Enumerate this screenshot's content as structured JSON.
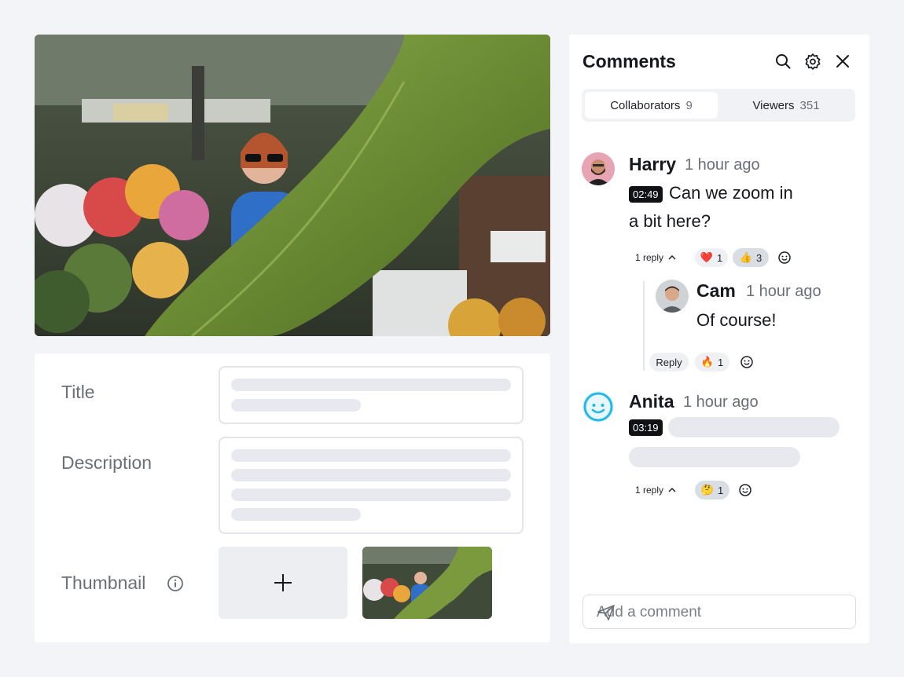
{
  "form": {
    "title_label": "Title",
    "description_label": "Description",
    "thumbnail_label": "Thumbnail",
    "upload_icon": "plus-icon",
    "info_icon": "info-icon"
  },
  "comments_panel": {
    "title": "Comments",
    "header_icons": [
      "search-icon",
      "gear-icon",
      "close-icon"
    ],
    "tabs": [
      {
        "label": "Collaborators",
        "count": "9",
        "active": true
      },
      {
        "label": "Viewers",
        "count": "351",
        "active": false
      }
    ],
    "comments": [
      {
        "author": "Harry",
        "time": "1 hour ago",
        "timestamp": "02:49",
        "text_line1": "Can we zoom in",
        "text_line2": "a bit here?",
        "reply_toggle": "1 reply",
        "reactions": [
          {
            "emoji": "❤️",
            "count": "1",
            "selected": false
          },
          {
            "emoji": "👍",
            "count": "3",
            "selected": true
          }
        ],
        "replies": [
          {
            "author": "Cam",
            "time": "1 hour ago",
            "text": "Of course!",
            "reply_label": "Reply",
            "reactions": [
              {
                "emoji": "🔥",
                "count": "1",
                "selected": false
              }
            ]
          }
        ]
      },
      {
        "author": "Anita",
        "time": "1 hour ago",
        "timestamp": "03:19",
        "reply_toggle": "1 reply",
        "reactions": [
          {
            "emoji": "🤔",
            "count": "1",
            "selected": true
          }
        ]
      }
    ],
    "add_comment_placeholder": "Add a comment",
    "send_icon": "send-icon"
  },
  "colors": {
    "background": "#f3f4f7",
    "panel": "#ffffff",
    "timestamp_badge": "#0f1115",
    "anita_avatar": "#25b7e8"
  }
}
